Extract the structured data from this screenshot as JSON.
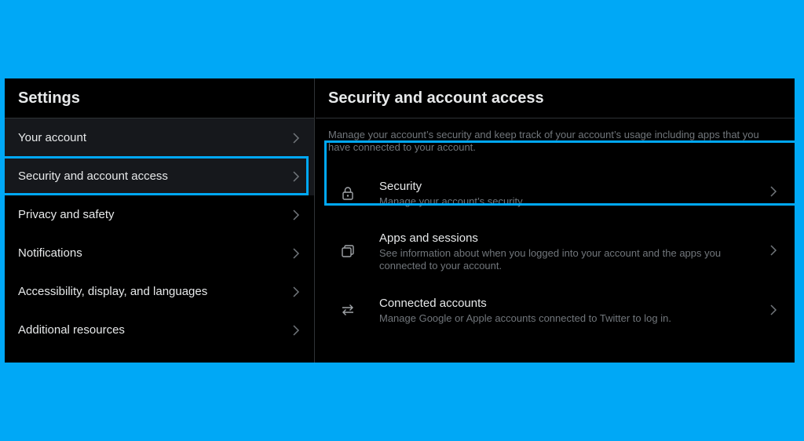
{
  "left": {
    "title": "Settings",
    "items": [
      {
        "label": "Your account"
      },
      {
        "label": "Security and account access"
      },
      {
        "label": "Privacy and safety"
      },
      {
        "label": "Notifications"
      },
      {
        "label": "Accessibility, display, and languages"
      },
      {
        "label": "Additional resources"
      }
    ]
  },
  "right": {
    "title": "Security and account access",
    "description": "Manage your account’s security and keep track of your account’s usage including apps that you have connected to your account.",
    "items": [
      {
        "title": "Security",
        "subtitle": "Manage your account’s security.",
        "icon": "lock-icon"
      },
      {
        "title": "Apps and sessions",
        "subtitle": "See information about when you logged into your account and the apps you connected to your account.",
        "icon": "apps-icon"
      },
      {
        "title": "Connected accounts",
        "subtitle": "Manage Google or Apple accounts connected to Twitter to log in.",
        "icon": "arrows-swap-icon"
      }
    ]
  },
  "colors": {
    "accent": "#00a8f6",
    "background": "#000000",
    "text": "#e7e9ea",
    "muted": "#71767b",
    "divider": "#2f3336",
    "hover": "#16181c"
  }
}
